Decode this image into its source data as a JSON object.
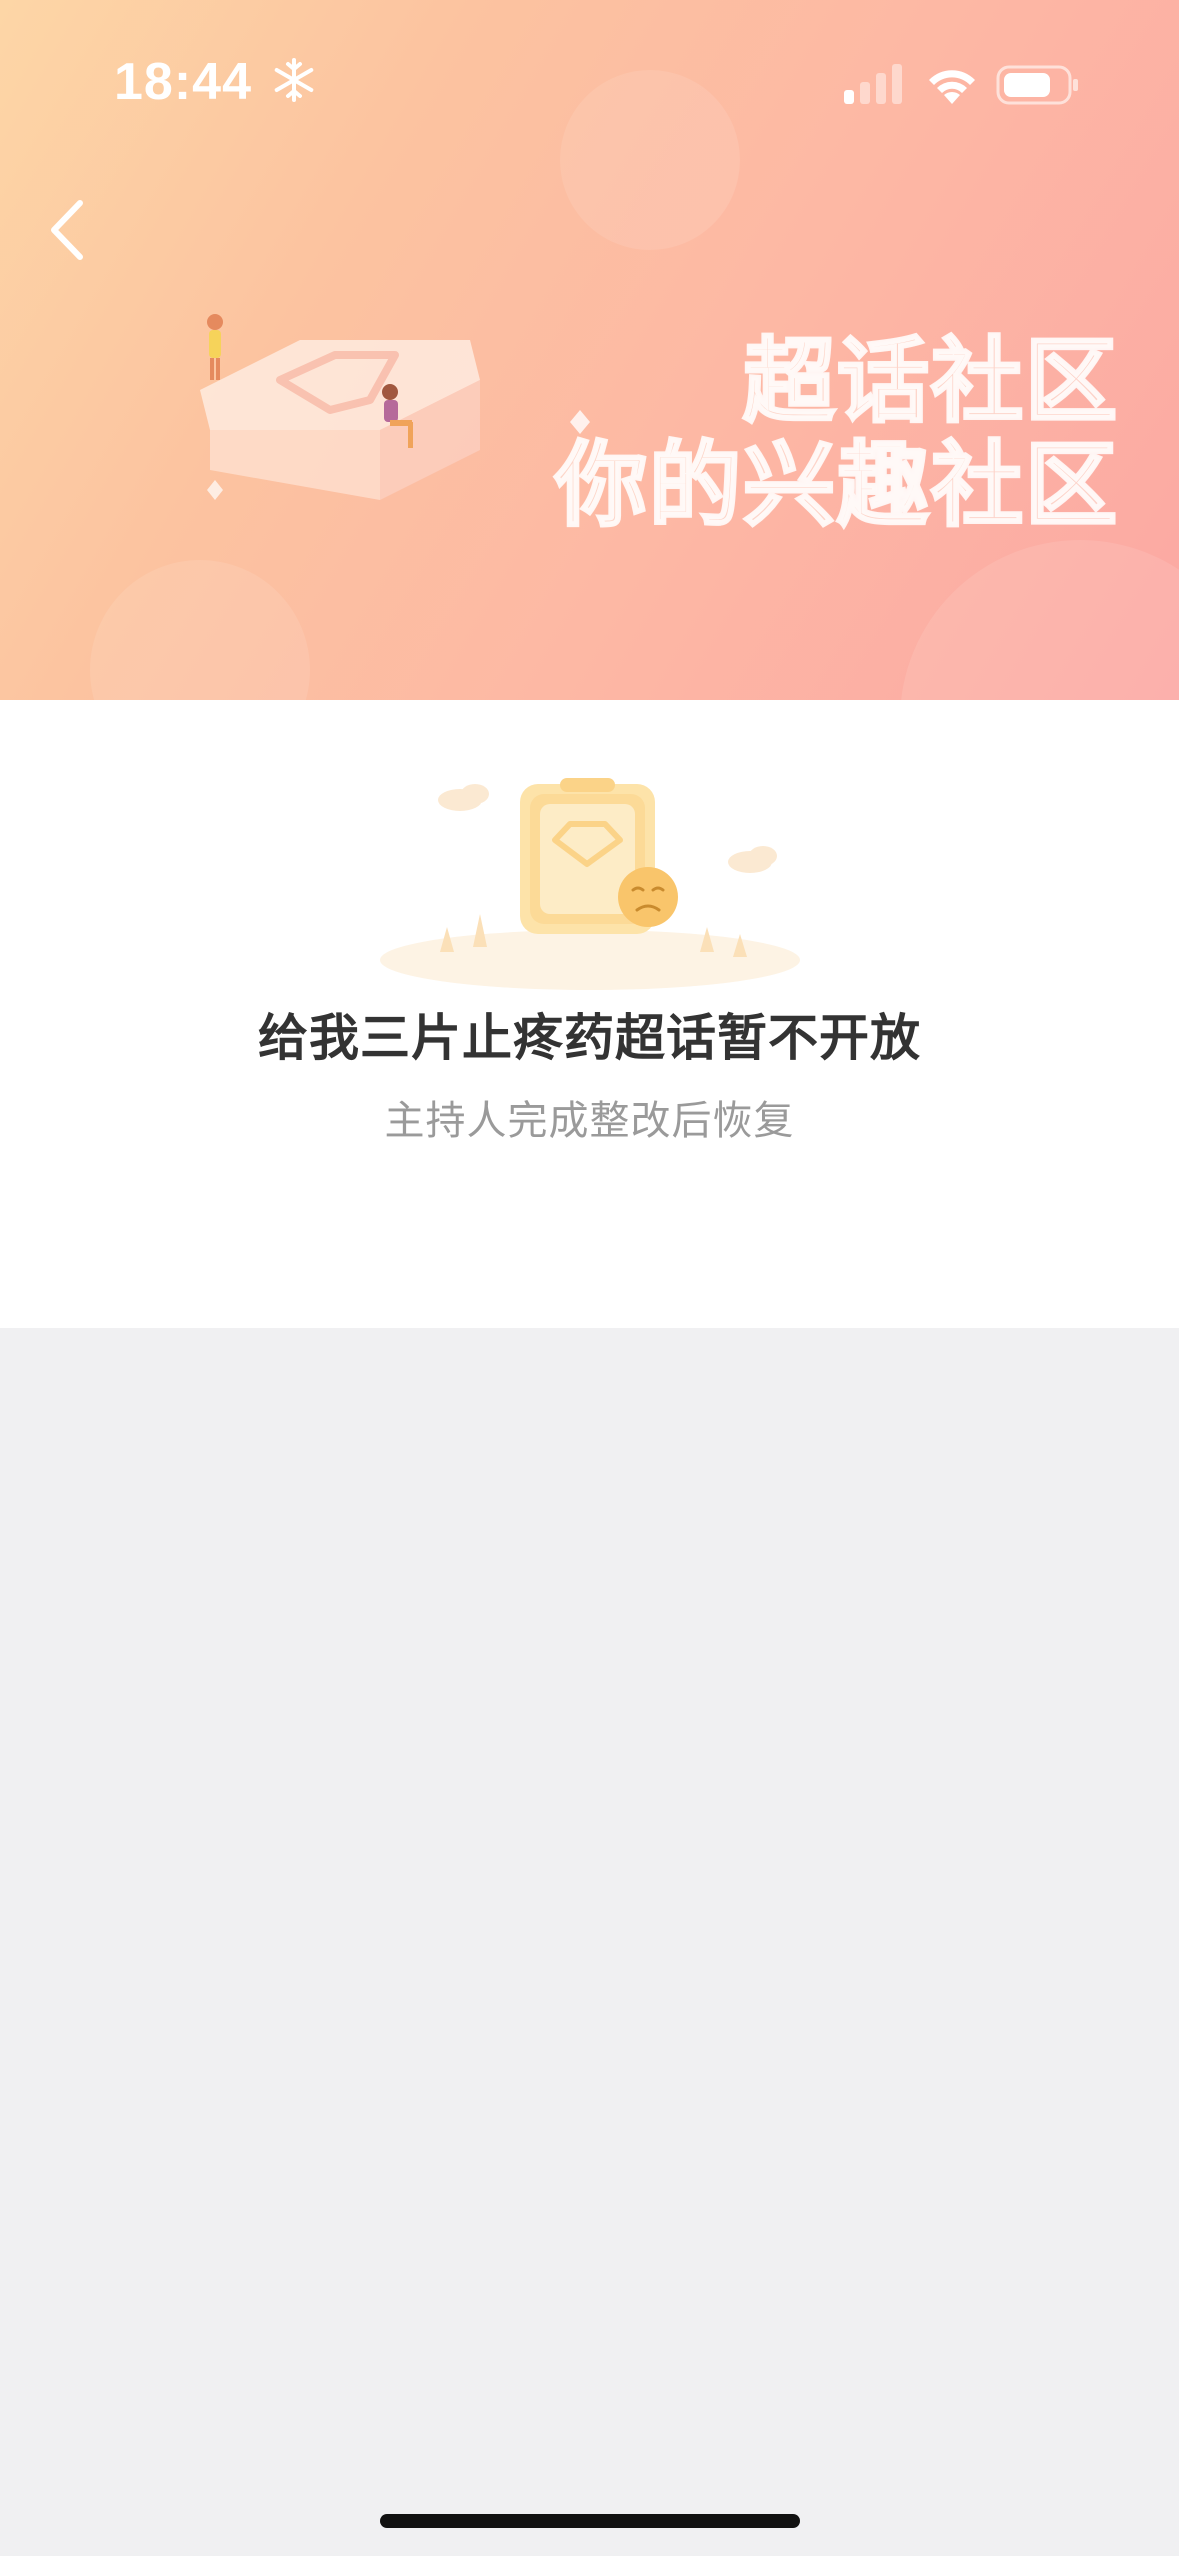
{
  "status_bar": {
    "time": "18:44",
    "mode_icon": "snowflake-icon",
    "signal_icon": "cellular-signal-icon",
    "wifi_icon": "wifi-icon",
    "battery_icon": "battery-icon"
  },
  "header": {
    "back_icon": "chevron-left-icon",
    "slogan_line1": "超话社区",
    "slogan_line2": "你的兴趣社区"
  },
  "notice": {
    "title": "给我三片止疼药超话暂不开放",
    "subtitle": "主持人完成整改后恢复"
  },
  "colors": {
    "banner_start": "#fdd6a6",
    "banner_end": "#fca8a3",
    "panel_bg": "#ffffff",
    "page_bg": "#f0f0f2",
    "title_text": "#333333",
    "subtitle_text": "#9a9a9a",
    "accent": "#f9c56b"
  }
}
